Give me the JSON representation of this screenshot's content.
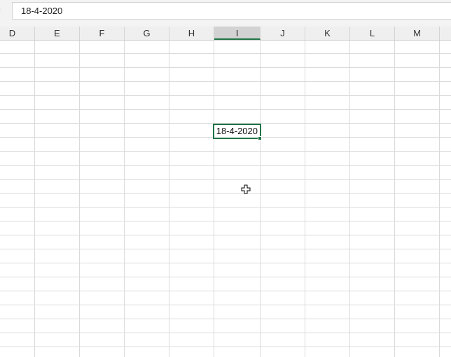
{
  "formula_bar": {
    "value": "18-4-2020"
  },
  "columns": [
    "D",
    "E",
    "F",
    "G",
    "H",
    "I",
    "J",
    "K",
    "L",
    "M"
  ],
  "selected_column": "I",
  "active_cell": {
    "value": "18-4-2020"
  },
  "colors": {
    "accent": "#217346",
    "header_bg": "#efefef",
    "selected_header_bg": "#d2d2d2",
    "gridline": "#dadada"
  },
  "cursor_icon": "plus-cross-cursor-icon"
}
